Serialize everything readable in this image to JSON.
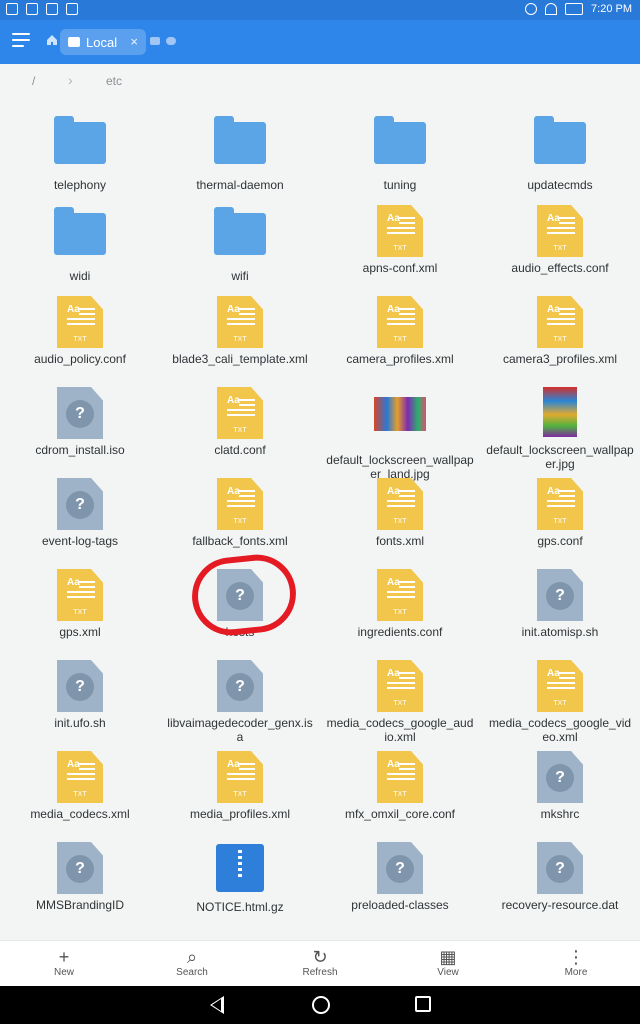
{
  "status_bar": {
    "time": "7:20 PM",
    "left_icons": [
      "signal-icon",
      "facebook-icon",
      "gallery-icon",
      "play-icon"
    ],
    "right_icons": [
      "info-icon",
      "wifi-icon",
      "battery-icon"
    ]
  },
  "app_bar": {
    "tab_label": "Local",
    "close": "×"
  },
  "breadcrumb": {
    "root": "/",
    "sep": "›",
    "current": "etc"
  },
  "items": [
    {
      "name": "telephony",
      "type": "folder"
    },
    {
      "name": "thermal-daemon",
      "type": "folder"
    },
    {
      "name": "tuning",
      "type": "folder"
    },
    {
      "name": "updatecmds",
      "type": "folder"
    },
    {
      "name": "widi",
      "type": "folder"
    },
    {
      "name": "wifi",
      "type": "folder"
    },
    {
      "name": "apns-conf.xml",
      "type": "txt"
    },
    {
      "name": "audio_effects.conf",
      "type": "txt"
    },
    {
      "name": "audio_policy.conf",
      "type": "txt"
    },
    {
      "name": "blade3_cali_template.xml",
      "type": "txt"
    },
    {
      "name": "camera_profiles.xml",
      "type": "txt"
    },
    {
      "name": "camera3_profiles.xml",
      "type": "txt"
    },
    {
      "name": "cdrom_install.iso",
      "type": "unknown"
    },
    {
      "name": "clatd.conf",
      "type": "txt"
    },
    {
      "name": "default_lockscreen_wallpaper_land.jpg",
      "type": "image-land"
    },
    {
      "name": "default_lockscreen_wallpaper.jpg",
      "type": "image-port"
    },
    {
      "name": "event-log-tags",
      "type": "unknown"
    },
    {
      "name": "fallback_fonts.xml",
      "type": "txt"
    },
    {
      "name": "fonts.xml",
      "type": "txt"
    },
    {
      "name": "gps.conf",
      "type": "txt"
    },
    {
      "name": "gps.xml",
      "type": "txt"
    },
    {
      "name": "hosts",
      "type": "unknown"
    },
    {
      "name": "ingredients.conf",
      "type": "txt"
    },
    {
      "name": "init.atomisp.sh",
      "type": "unknown"
    },
    {
      "name": "init.ufo.sh",
      "type": "unknown"
    },
    {
      "name": "libvaimagedecoder_genx.isa",
      "type": "unknown"
    },
    {
      "name": "media_codecs_google_audio.xml",
      "type": "txt"
    },
    {
      "name": "media_codecs_google_video.xml",
      "type": "txt"
    },
    {
      "name": "media_codecs.xml",
      "type": "txt"
    },
    {
      "name": "media_profiles.xml",
      "type": "txt"
    },
    {
      "name": "mfx_omxil_core.conf",
      "type": "txt"
    },
    {
      "name": "mkshrc",
      "type": "unknown"
    },
    {
      "name": "MMSBrandingID",
      "type": "unknown"
    },
    {
      "name": "NOTICE.html.gz",
      "type": "zip"
    },
    {
      "name": "preloaded-classes",
      "type": "unknown"
    },
    {
      "name": "recovery-resource.dat",
      "type": "unknown"
    }
  ],
  "bottom_bar": [
    {
      "label": "New",
      "icon": "plus-icon",
      "glyph": "+"
    },
    {
      "label": "Search",
      "icon": "search-icon",
      "glyph": "⌕"
    },
    {
      "label": "Refresh",
      "icon": "refresh-icon",
      "glyph": "↻"
    },
    {
      "label": "View",
      "icon": "grid-view-icon",
      "glyph": "▦"
    },
    {
      "label": "More",
      "icon": "more-icon",
      "glyph": "⋮"
    }
  ],
  "icon_text": {
    "txt_aa": "Aa",
    "txt_ext": "TXT",
    "unknown_mark": "?"
  },
  "colors": {
    "accent": "#2f86ea",
    "folder": "#5ba5e6",
    "txt": "#f2c64a",
    "unknown": "#9eb3c8",
    "highlight": "#e41b23"
  }
}
